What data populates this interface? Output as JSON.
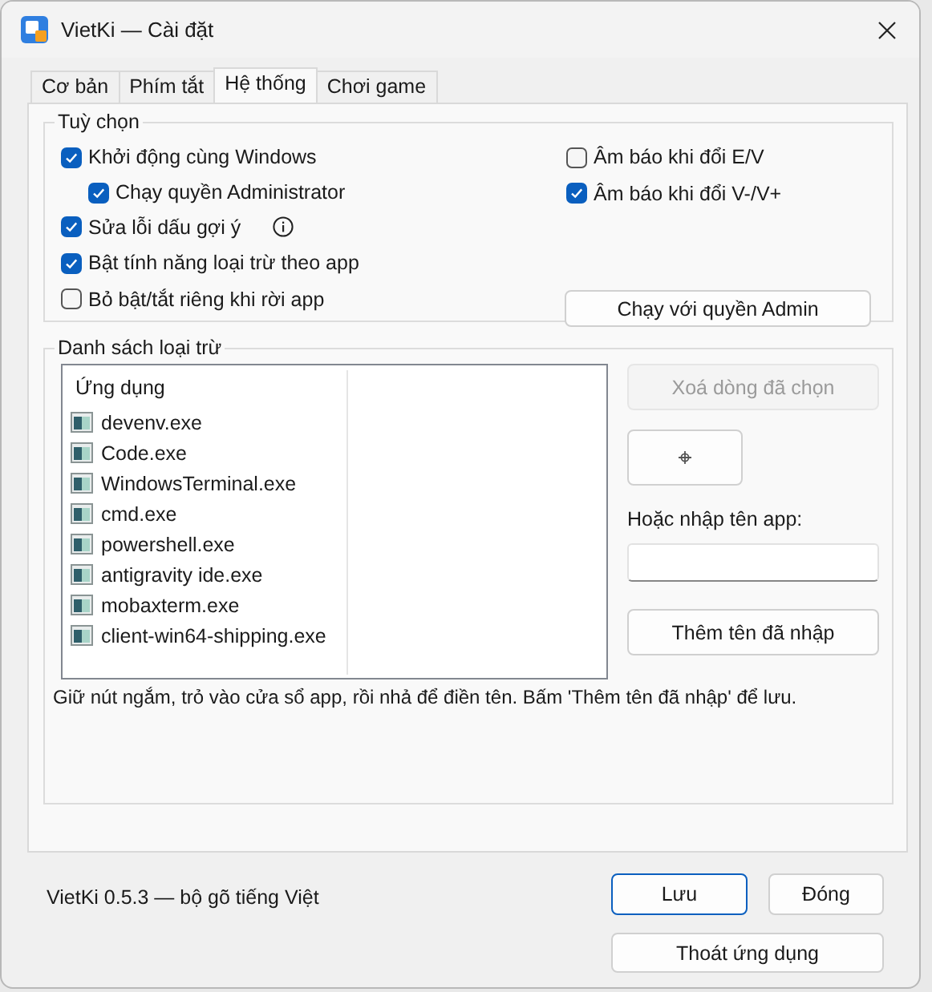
{
  "window": {
    "title": "VietKi — Cài đặt"
  },
  "tabs": [
    {
      "label": "Cơ bản",
      "selected": false
    },
    {
      "label": "Phím tắt",
      "selected": false
    },
    {
      "label": "Hệ thống",
      "selected": true
    },
    {
      "label": "Chơi game",
      "selected": false
    }
  ],
  "options_group": {
    "title": "Tuỳ chọn",
    "left": [
      {
        "label": "Khởi động cùng Windows",
        "checked": true,
        "children": [
          {
            "label": "Chạy quyền Administrator",
            "checked": true
          }
        ]
      },
      {
        "label": "Sửa lỗi dấu gợi ý",
        "checked": true,
        "info_icon": true
      },
      {
        "label": "Bật tính năng loại trừ theo app",
        "checked": true
      },
      {
        "label": "Bỏ bật/tắt riêng khi rời app",
        "checked": false
      }
    ],
    "right": [
      {
        "label": "Âm báo khi đổi E/V",
        "checked": false
      },
      {
        "label": "Âm báo khi đổi V-/V+",
        "checked": true
      }
    ],
    "admin_button": {
      "label": "Chạy với quyền Admin"
    }
  },
  "exclusion_group": {
    "title": "Danh sách loại trừ",
    "list": {
      "column": "Ứng dụng",
      "items": [
        "devenv.exe",
        "Code.exe",
        "WindowsTerminal.exe",
        "cmd.exe",
        "powershell.exe",
        "antigravity ide.exe",
        "mobaxterm.exe",
        "client-win64-shipping.exe"
      ]
    },
    "delete_button": {
      "label": "Xoá dòng đã chọn",
      "disabled": true
    },
    "input_label": "Hoặc nhập tên app:",
    "add_button": {
      "label": "Thêm tên đã nhập"
    },
    "hint": "Giữ nút ngắm, trỏ vào cửa sổ app, rồi nhả để điền tên. Bấm 'Thêm tên đã nhập' để lưu."
  },
  "footer": {
    "version": "VietKi 0.5.3 — bộ gõ tiếng Việt",
    "buttons": [
      {
        "label": "Lưu",
        "default": true
      },
      {
        "label": "Đóng",
        "default": false
      }
    ],
    "quit_button": {
      "label": "Thoát ứng dụng"
    }
  }
}
